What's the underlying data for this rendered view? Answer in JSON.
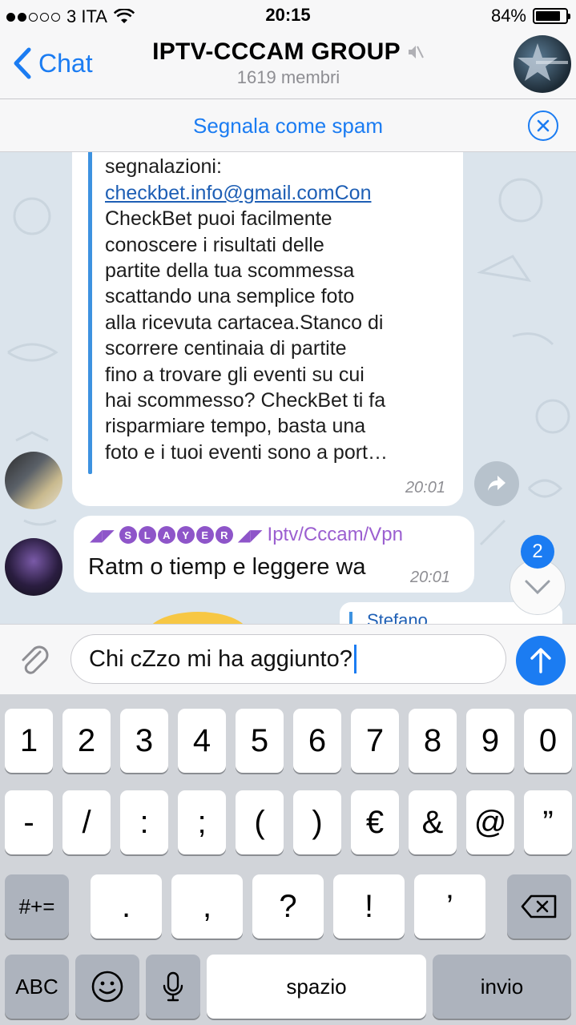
{
  "status_bar": {
    "carrier": "3 ITA",
    "time": "20:15",
    "battery_percent": "84%",
    "battery_level": 0.84,
    "signal_bars_filled": 2,
    "signal_bars_total": 5
  },
  "nav": {
    "back_label": "Chat",
    "title": "IPTV-CCCAM GROUP",
    "subtitle": "1619 membri"
  },
  "spam_bar": {
    "label": "Segnala come spam"
  },
  "messages": {
    "m1": {
      "text_before_link": "continuate a seguirci. Per bug e\nsegnalazioni:",
      "link": "checkbet.info@gmail.comCon",
      "text_after_link": "CheckBet puoi facilmente\nconoscere i risultati delle\npartite della tua scommessa\nscattando una semplice foto\nalla ricevuta cartacea.Stanco di\nscorrere centinaia di partite\nfino a trovare gli eventi su cui\nhai scommesso? CheckBet ti fa\nrisparmiare tempo, basta una\nfoto e i tuoi eventi sono a port…",
      "time": "20:01"
    },
    "m2": {
      "sender_letters": [
        "S",
        "L",
        "A",
        "Y",
        "E",
        "R"
      ],
      "sender_suffix": "Iptv/Cccam/Vpn",
      "text": "Ratm o tiemp e leggere wa",
      "time": "20:01"
    },
    "m3_partial": {
      "reply_name": "Stefano"
    }
  },
  "scroll": {
    "unread_count": "2"
  },
  "input": {
    "text": "Chi cZzo mi ha aggiunto?"
  },
  "keyboard": {
    "row1": [
      "1",
      "2",
      "3",
      "4",
      "5",
      "6",
      "7",
      "8",
      "9",
      "0"
    ],
    "row2": [
      "-",
      "/",
      ":",
      ";",
      "(",
      ")",
      "€",
      "&",
      "@",
      "”"
    ],
    "row3_left": "#+=",
    "row3": [
      ".",
      ",",
      "?",
      "!",
      "’"
    ],
    "row4_abc": "ABC",
    "row4_space": "spazio",
    "row4_return": "invio"
  },
  "colors": {
    "accent": "#1b7cf2",
    "chat_bg": "#dbe4ec",
    "sender_purple": "#9b5fd0"
  },
  "icons": {
    "back": "chevron-left-icon",
    "mute": "muted-speaker-icon",
    "close": "close-circle-icon",
    "forward": "share-arrow-icon",
    "scroll_down": "chevron-down-icon",
    "attach": "paperclip-icon",
    "send": "arrow-up-icon",
    "delete": "backspace-icon",
    "emoji": "smiley-icon",
    "mic": "microphone-icon"
  }
}
